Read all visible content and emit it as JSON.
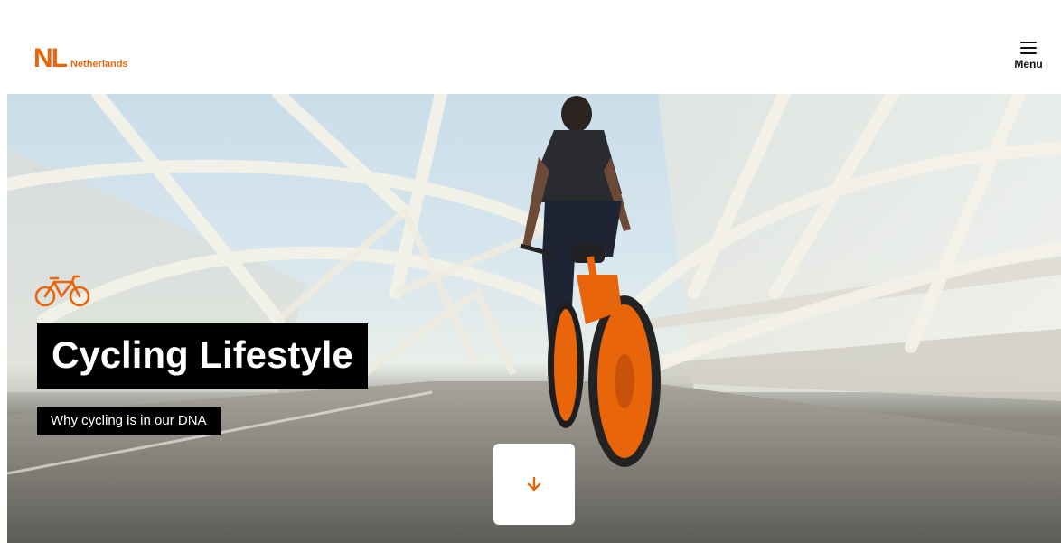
{
  "header": {
    "logo_mark": "NL",
    "logo_text": "Netherlands",
    "menu_label": "Menu"
  },
  "hero": {
    "category_icon": "bicycle-icon",
    "title": "Cycling Lifestyle",
    "subtitle": "Why cycling is in our DNA",
    "scroll_icon": "arrow-down-icon"
  },
  "colors": {
    "brand_orange": "#e8650a",
    "title_bg": "#000000",
    "text_light": "#ffffff"
  }
}
